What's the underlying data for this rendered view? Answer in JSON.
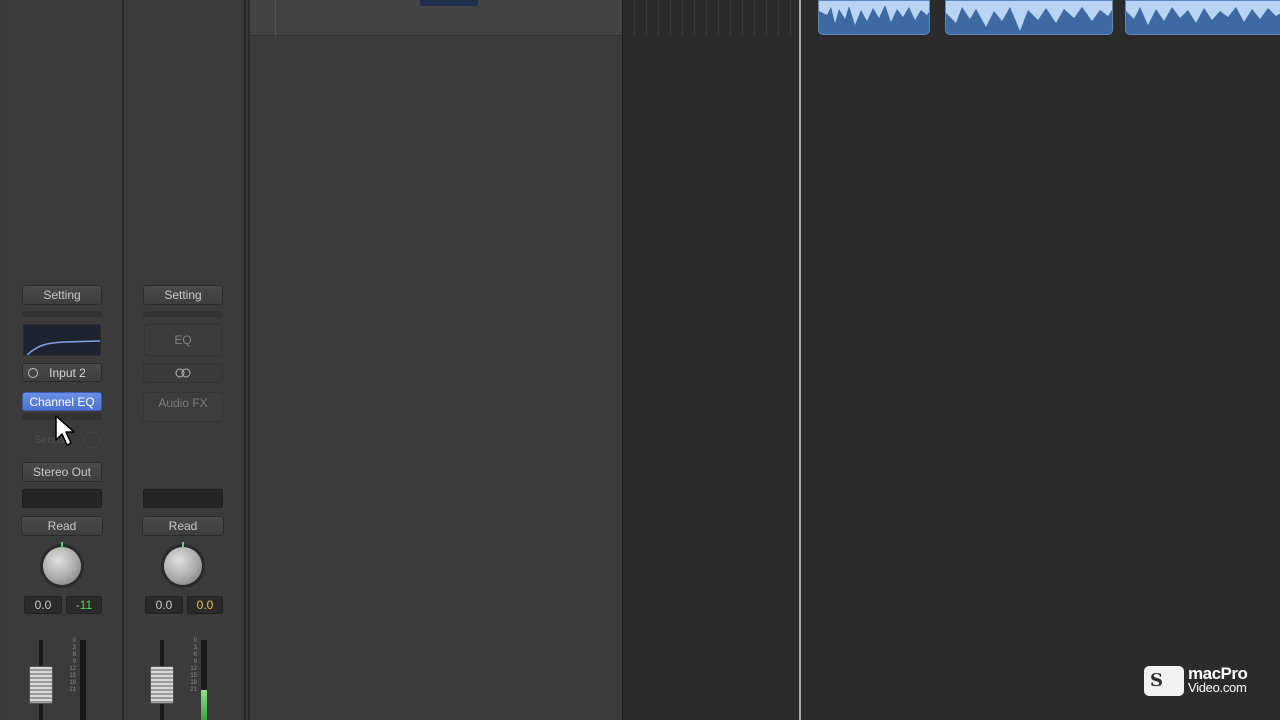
{
  "mixer": {
    "strips": [
      {
        "setting_label": "Setting",
        "input_label": "Input 2",
        "plugin_label": "Channel EQ",
        "sends_label": "Sends",
        "output_label": "Stereo Out",
        "automation_label": "Read",
        "pan_value": "0.0",
        "level_value": "-11"
      },
      {
        "setting_label": "Setting",
        "eq_label": "EQ",
        "plugin_label": "Audio FX",
        "automation_label": "Read",
        "pan_value": "0.0",
        "level_value": "0.0"
      }
    ],
    "meter_scale": [
      "0",
      "3",
      "6",
      "9",
      "12",
      "15",
      "18",
      "21"
    ]
  },
  "colors": {
    "plugin_active": "#5a80db",
    "level_green": "#4cd65b",
    "level_yellow": "#e2c440",
    "region_blue": "#3d6aa3"
  },
  "logo": {
    "line1": "macPro",
    "line2": "Video.com"
  }
}
